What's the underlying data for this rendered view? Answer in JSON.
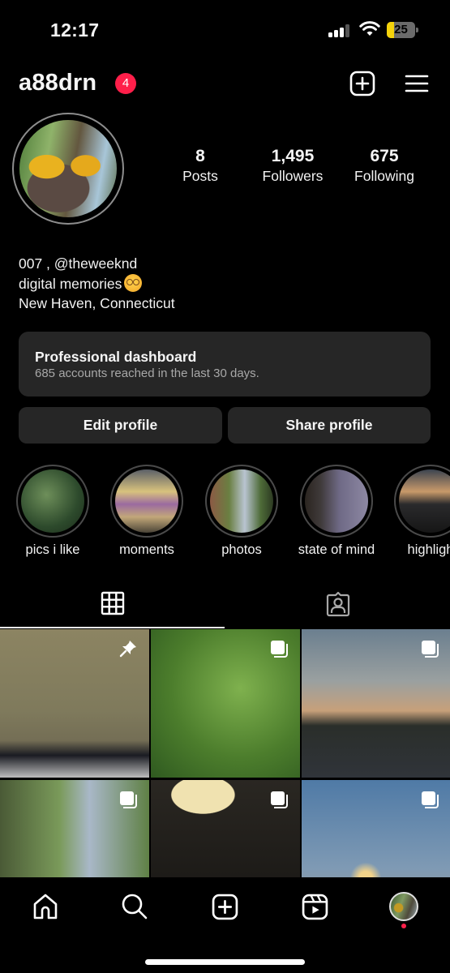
{
  "status_bar": {
    "time": "12:17",
    "battery_percent": "25",
    "battery_level": 0.25,
    "battery_mode_color": "#f5d30b",
    "signal_bars_active": 3,
    "signal_bars_total": 4,
    "icons": [
      "cellular-signal-icon",
      "wifi-icon",
      "battery-icon"
    ]
  },
  "header": {
    "username": "a88drn",
    "notification_count": "4",
    "badge_color": "#ff1f4a",
    "actions": [
      {
        "name": "create-icon",
        "label": "Create"
      },
      {
        "name": "menu-icon",
        "label": "Menu"
      }
    ]
  },
  "profile": {
    "stats": [
      {
        "value": "8",
        "label": "Posts"
      },
      {
        "value": "1,495",
        "label": "Followers"
      },
      {
        "value": "675",
        "label": "Following"
      }
    ],
    "bio": {
      "line1": "007 , @theweeknd",
      "line2": "digital memories",
      "line2_emoji": "face-with-spiral-eyes",
      "line3": "New Haven, Connecticut"
    }
  },
  "dashboard": {
    "title": "Professional dashboard",
    "subtitle": "685 accounts reached in the last 30 days."
  },
  "buttons": {
    "edit_profile": "Edit profile",
    "share_profile": "Share profile"
  },
  "highlights": [
    {
      "label": "pics i like"
    },
    {
      "label": "moments"
    },
    {
      "label": "photos"
    },
    {
      "label": "state of mind"
    },
    {
      "label": "highligh"
    }
  ],
  "tabs": [
    {
      "name": "posts-grid",
      "icon": "grid-icon",
      "active": true
    },
    {
      "name": "tagged",
      "icon": "tagged-person-icon",
      "active": false
    }
  ],
  "posts": [
    {
      "overlay": "pin-icon",
      "subject": "feet on sidewalk"
    },
    {
      "overlay": "carousel-icon",
      "subject": "tree canopy"
    },
    {
      "overlay": "carousel-icon",
      "subject": "sunset parking lot"
    },
    {
      "overlay": "carousel-icon",
      "subject": "trees and power lines"
    },
    {
      "overlay": "carousel-icon",
      "subject": "ceiling lights"
    },
    {
      "overlay": "carousel-icon",
      "subject": "sun over lake"
    }
  ],
  "bottom_nav": {
    "items": [
      "home-icon",
      "search-icon",
      "create-icon",
      "reels-icon",
      "profile-avatar"
    ],
    "profile_dot_color": "#ff1f4a"
  }
}
